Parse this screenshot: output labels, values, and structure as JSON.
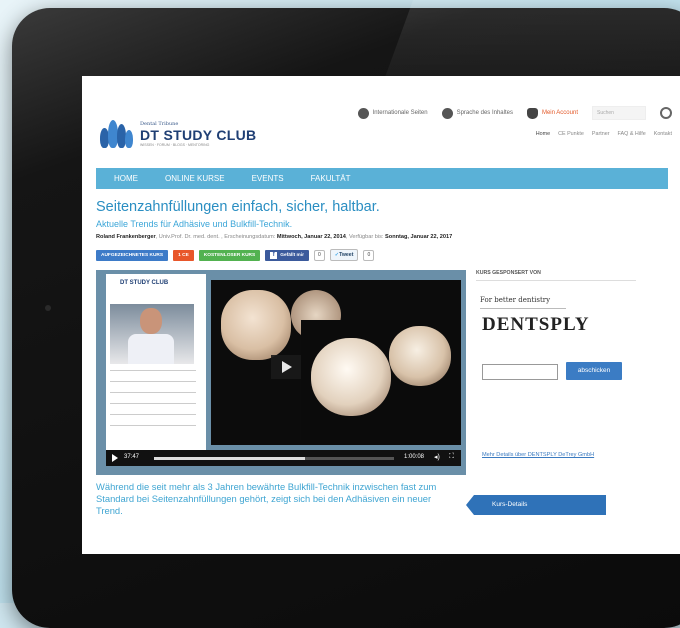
{
  "top_nav": {
    "internationale": "Internationale Seiten",
    "sprache": "Sprache des Inhaltes",
    "my_account": "Mein Account",
    "search_placeholder": "Suchen"
  },
  "sub_nav": [
    "Home",
    "CE Punkte",
    "Partner",
    "FAQ & Hilfe",
    "Kontakt"
  ],
  "logo": {
    "small": "Dental Tribune",
    "big": "DT STUDY CLUB",
    "tagline": "WISSEN · FORUM · BLOGS · MENTORING"
  },
  "main_nav": [
    "HOME",
    "ONLINE KURSE",
    "EVENTS",
    "FAKULTÄT"
  ],
  "course": {
    "title": "Seitenzahnfüllungen einfach, sicher, haltbar.",
    "subtitle": "Aktuelle Trends für Adhäsive und Bulkfill-Technik.",
    "author": "Roland Frankenberger",
    "author_suffix": ", Univ.Prof. Dr. med. dent. , Erscheinungsdatum: ",
    "pub_date": "Mittwoch, Januar 22, 2014",
    "avail_label": ", Verfügbar bis: ",
    "avail_date": "Sonntag, Januar 22, 2017"
  },
  "badges": {
    "recorded": "AUFGEZEICHNETES KURS",
    "ce": "1 CE",
    "free": "KOSTENLOSER KURS",
    "fb_like": "Gefällt mir",
    "fb_count": "0",
    "tweet": "Tweet",
    "tweet_count": "0"
  },
  "player": {
    "slide_logo": "DT STUDY CLUB",
    "current_time": "37:47",
    "duration": "1:00:08",
    "progress": 0.63
  },
  "description": "Während die seit mehr als 3 Jahren bewährte Bulkfill-Technik inzwischen fast zum Standard bei Seitenzahnfüllungen gehört, zeigt sich bei den Adhäsiven ein neuer Trend.",
  "sponsor": {
    "heading": "KURS GESPONSERT VON",
    "tagline": "For better dentistry",
    "logo": "DENTSPLY",
    "submit": "abschicken",
    "link": "Mehr Details über DENTSPLY DeTrey GmbH"
  },
  "kurs_details": "Kurs-Details"
}
